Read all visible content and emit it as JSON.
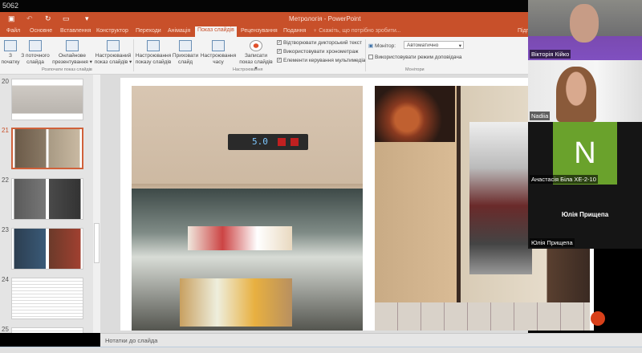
{
  "topbar": {
    "text": "5062"
  },
  "app": {
    "title": "Метрологія - PowerPoint"
  },
  "tabs": [
    "Файл",
    "Основне",
    "Вставлення",
    "Конструктор",
    "Переходи",
    "Анімація",
    "Показ слайдів",
    "Рецензування",
    "Подання"
  ],
  "tell_me": "Скажіть, що потрібно зробити...",
  "sign_in": "Підп",
  "ribbon": {
    "buttons": [
      {
        "label": "З початку"
      },
      {
        "label": "З поточного слайда"
      },
      {
        "label": "Онлайнове презентування ▾"
      },
      {
        "label": "Настроюваний показ слайдів ▾"
      },
      {
        "label": "Настроювання показу слайдів"
      },
      {
        "label": "Приховати слайд"
      },
      {
        "label": "Настроювання часу"
      },
      {
        "label": "Записати показ слайдів ▾"
      }
    ],
    "groups": [
      "Розпочати показ слайдів",
      "Настроювання",
      "Монітори"
    ],
    "checks": [
      {
        "label": "Відтворювати дикторський текст",
        "checked": true
      },
      {
        "label": "Використовувати хронометраж",
        "checked": true
      },
      {
        "label": "Елементи керування мультимедіа",
        "checked": true
      }
    ],
    "monitor_label": "Монітор:",
    "monitor_value": "Автоматично",
    "presenter_view": {
      "label": "Використовувати режим доповідача",
      "checked": false
    }
  },
  "thumbnails": [
    {
      "n": "20"
    },
    {
      "n": "21",
      "selected": true
    },
    {
      "n": "22"
    },
    {
      "n": "23"
    },
    {
      "n": "24"
    },
    {
      "n": "25"
    }
  ],
  "slide": {
    "display_reading": "5.0"
  },
  "notes": "Нотатки до слайда",
  "participants": [
    {
      "name": "Вікторія Кійко"
    },
    {
      "name": "Nadiia"
    },
    {
      "name": "Анастасія Біла ХЕ-2-10",
      "initial": "N"
    },
    {
      "name": "Юлія Прищепа",
      "center": "Юлія Прищепа"
    }
  ],
  "colors": {
    "accent": "#c8502a",
    "avatar": "#6aa22c"
  }
}
